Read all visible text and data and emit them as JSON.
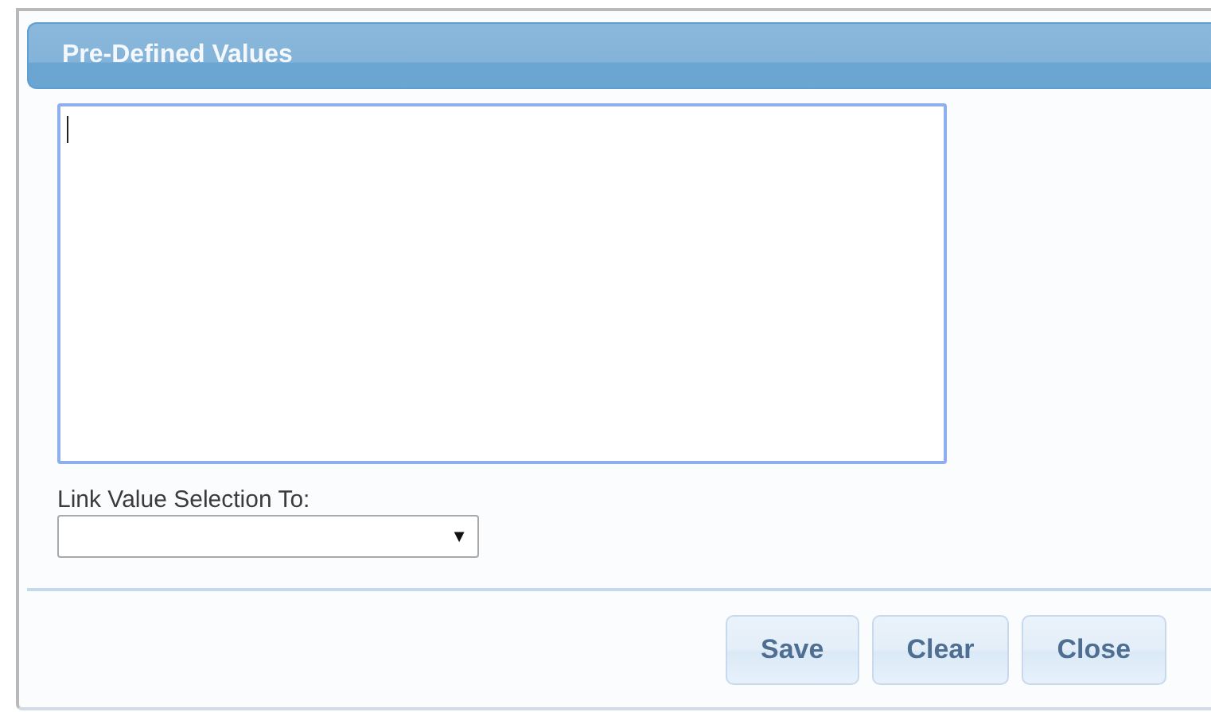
{
  "dialog": {
    "title": "Pre-Defined Values"
  },
  "values_field": {
    "focused": true
  },
  "link_select": {
    "label": "Link Value Selection To:",
    "arrow": "▼"
  },
  "buttons": [
    {
      "label": "Save"
    },
    {
      "label": "Clear"
    },
    {
      "label": "Close"
    }
  ]
}
